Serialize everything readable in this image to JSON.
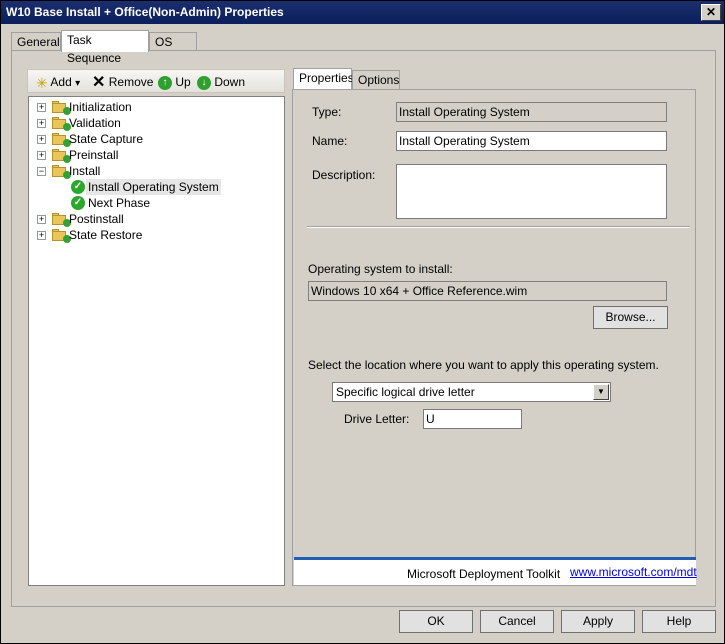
{
  "window": {
    "title": "W10 Base Install + Office(Non-Admin) Properties",
    "close_glyph": "✕"
  },
  "tabs": [
    {
      "label": "General"
    },
    {
      "label": "Task Sequence"
    },
    {
      "label": "OS Info"
    }
  ],
  "toolbar": {
    "add_label": "Add",
    "add_arrow": "▾",
    "remove_label": "Remove",
    "up_label": "Up",
    "down_label": "Down"
  },
  "tree": {
    "items": [
      {
        "label": "Initialization"
      },
      {
        "label": "Validation"
      },
      {
        "label": "State Capture"
      },
      {
        "label": "Preinstall"
      },
      {
        "label": "Install"
      },
      {
        "label": "Install Operating System"
      },
      {
        "label": "Next Phase"
      },
      {
        "label": "Postinstall"
      },
      {
        "label": "State Restore"
      }
    ],
    "expand_glyph": "+",
    "collapse_glyph": "−",
    "check_glyph": "✓"
  },
  "right_tabs": [
    {
      "label": "Properties"
    },
    {
      "label": "Options"
    }
  ],
  "properties": {
    "type_label": "Type:",
    "type_value": "Install Operating System",
    "name_label": "Name:",
    "name_value": "Install Operating System",
    "description_label": "Description:",
    "description_value": "",
    "os_label": "Operating system to install:",
    "os_value": "Windows 10 x64 + Office Reference.wim",
    "browse_label": "Browse...",
    "location_label": "Select the location where you want to apply this operating system.",
    "location_select": "Specific logical drive letter",
    "drive_letter_label": "Drive Letter:",
    "drive_letter_value": "U"
  },
  "footer": {
    "product": "Microsoft Deployment Toolkit",
    "link": "www.microsoft.com/mdt"
  },
  "buttons": {
    "ok": "OK",
    "cancel": "Cancel",
    "apply": "Apply",
    "help": "Help"
  }
}
